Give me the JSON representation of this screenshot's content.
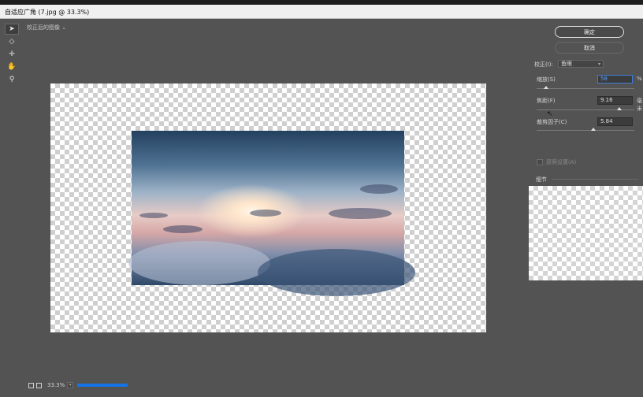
{
  "window": {
    "title": "自适应广角 (7.jpg @ 33.3%)",
    "canvas_label": "校正后的图像",
    "canvas_label_chevron": "⌄"
  },
  "tools": [
    "selection-arrow",
    "constraint",
    "move",
    "hand",
    "zoom"
  ],
  "buttons": {
    "ok": "确定",
    "cancel": "取消"
  },
  "settings": {
    "correction_label": "校正(I):",
    "correction_value": "鱼眼",
    "scale_label": "缩放(S)",
    "scale_value": "58",
    "scale_unit": "%",
    "scale_level": 0.1,
    "focal_label": "焦距(F)",
    "focal_value": "9.16",
    "focal_unit": "毫米",
    "focal_level": 0.85,
    "crop_label": "裁剪因子(C)",
    "crop_value": "5.84",
    "crop_level": 0.58,
    "as_shot_label": "原照设置(A)",
    "detail_label": "细节"
  },
  "status": {
    "zoom": "33.3%",
    "progress": 1.0
  },
  "colors": {
    "accent": "#1473e6",
    "focus": "#3f7fd6"
  }
}
